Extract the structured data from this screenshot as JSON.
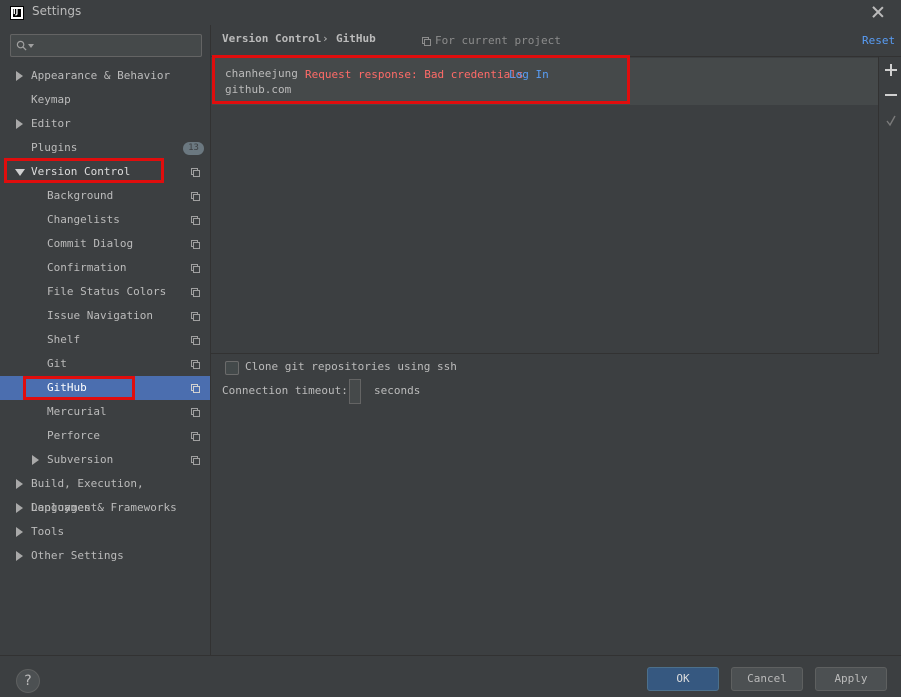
{
  "window": {
    "title": "Settings",
    "app_icon_text": "IJ"
  },
  "search": {
    "placeholder": "",
    "value": ""
  },
  "sidebar": {
    "items": [
      {
        "label": "Appearance & Behavior"
      },
      {
        "label": "Keymap"
      },
      {
        "label": "Editor"
      },
      {
        "label": "Plugins",
        "badge": "13"
      },
      {
        "label": "Version Control"
      },
      {
        "label": "Background"
      },
      {
        "label": "Changelists"
      },
      {
        "label": "Commit Dialog"
      },
      {
        "label": "Confirmation"
      },
      {
        "label": "File Status Colors"
      },
      {
        "label": "Issue Navigation"
      },
      {
        "label": "Shelf"
      },
      {
        "label": "Git"
      },
      {
        "label": "GitHub"
      },
      {
        "label": "Mercurial"
      },
      {
        "label": "Perforce"
      },
      {
        "label": "Subversion"
      },
      {
        "label": "Build, Execution, Deployment"
      },
      {
        "label": "Languages & Frameworks"
      },
      {
        "label": "Tools"
      },
      {
        "label": "Other Settings"
      }
    ]
  },
  "header": {
    "breadcrumb": [
      "Version Control",
      "GitHub"
    ],
    "separator": "›",
    "project_note": "For current project",
    "reset": "Reset"
  },
  "account": {
    "username": "chanheejung",
    "error": "Request response: Bad credentials",
    "login": "Log In",
    "host": "github.com"
  },
  "options": {
    "clone_ssh_label": "Clone git repositories using ssh",
    "clone_ssh_checked": false,
    "timeout_label": "Connection timeout:",
    "timeout_value": "",
    "timeout_unit": "seconds"
  },
  "footer": {
    "help": "?",
    "ok": "OK",
    "cancel": "Cancel",
    "apply": "Apply"
  },
  "colors": {
    "accent": "#4b6eaf",
    "error": "#ff6b68",
    "link": "#589df6",
    "highlight": "#e00d0d"
  }
}
